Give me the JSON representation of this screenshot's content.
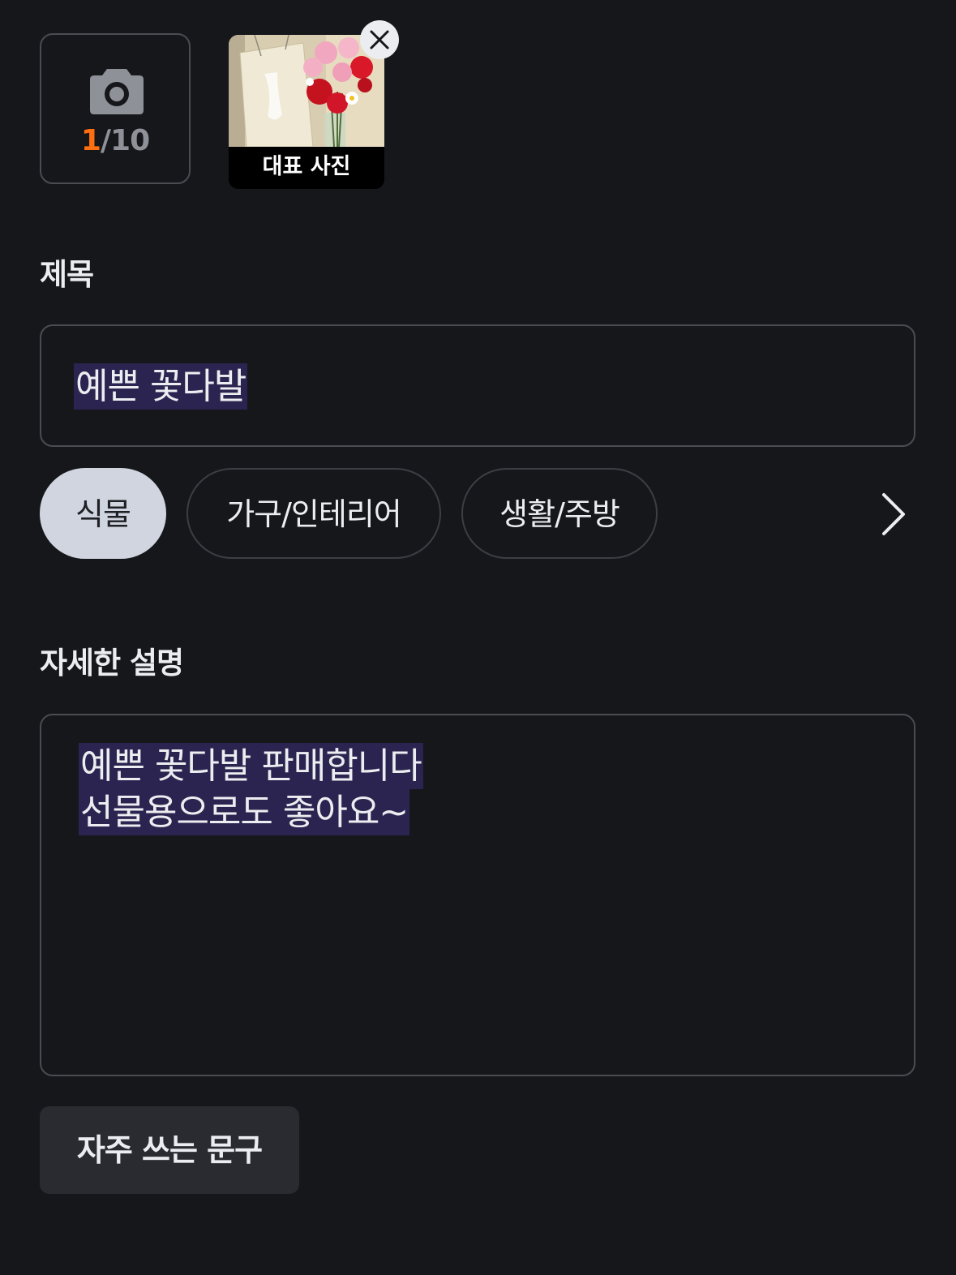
{
  "photos": {
    "camera_icon": "camera-icon",
    "count_current": "1",
    "count_max": "/10",
    "count_current_color": "#ff6f0f",
    "thumbnail_caption": "대표 사진",
    "remove_icon": "close-icon"
  },
  "title_section": {
    "label": "제목",
    "value": "예쁜 꽃다발"
  },
  "categories": {
    "items": [
      {
        "label": "식물",
        "selected": true
      },
      {
        "label": "가구/인테리어",
        "selected": false
      },
      {
        "label": "생활/주방",
        "selected": false
      }
    ],
    "more_icon": "chevron-right-icon"
  },
  "description_section": {
    "label": "자세한 설명",
    "lines": [
      "예쁜 꽃다발 판매합니다",
      "선물용으로도 좋아요~"
    ]
  },
  "phrases_button": {
    "label": "자주 쓰는 문구"
  },
  "colors": {
    "background": "#16171b",
    "selection_highlight": "#2b2450",
    "chip_selected_bg": "#d1d5e0",
    "accent": "#ff6f0f"
  }
}
